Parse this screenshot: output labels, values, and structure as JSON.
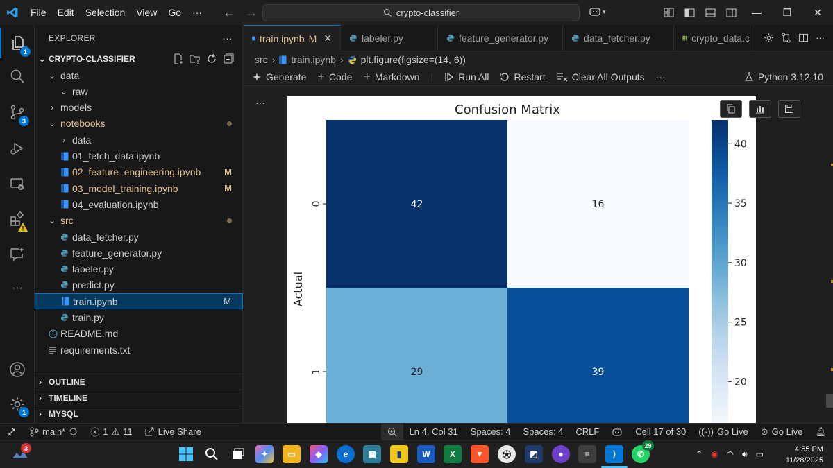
{
  "menu": {
    "file": "File",
    "edit": "Edit",
    "selection": "Selection",
    "view": "View",
    "go": "Go",
    "more": "···"
  },
  "search": {
    "text": "crypto-classifier"
  },
  "activity_badges": {
    "explorer": "1",
    "source_control": "3",
    "accounts_settings": "1"
  },
  "explorer": {
    "title": "EXPLORER",
    "project": "CRYPTO-CLASSIFIER",
    "items": [
      {
        "label": "data",
        "type": "folder-open",
        "indent": 1
      },
      {
        "label": "raw",
        "type": "folder-open",
        "indent": 2
      },
      {
        "label": "models",
        "type": "folder",
        "indent": 1
      },
      {
        "label": "notebooks",
        "type": "folder-open",
        "indent": 1,
        "modified": true,
        "status": "dot"
      },
      {
        "label": "data",
        "type": "folder",
        "indent": 2
      },
      {
        "label": "01_fetch_data.ipynb",
        "type": "notebook",
        "indent": 2
      },
      {
        "label": "02_feature_engineering.ipynb",
        "type": "notebook",
        "indent": 2,
        "modified": true,
        "status": "M"
      },
      {
        "label": "03_model_training.ipynb",
        "type": "notebook",
        "indent": 2,
        "modified": true,
        "status": "M"
      },
      {
        "label": "04_evaluation.ipynb",
        "type": "notebook",
        "indent": 2
      },
      {
        "label": "src",
        "type": "folder-open",
        "indent": 1,
        "modified": true,
        "status": "dot"
      },
      {
        "label": "data_fetcher.py",
        "type": "python",
        "indent": 2
      },
      {
        "label": "feature_generator.py",
        "type": "python",
        "indent": 2
      },
      {
        "label": "labeler.py",
        "type": "python",
        "indent": 2
      },
      {
        "label": "predict.py",
        "type": "python",
        "indent": 2
      },
      {
        "label": "train.ipynb",
        "type": "notebook",
        "indent": 2,
        "selected": true,
        "status": "M"
      },
      {
        "label": "train.py",
        "type": "python",
        "indent": 2
      },
      {
        "label": "README.md",
        "type": "info",
        "indent": 1
      },
      {
        "label": "requirements.txt",
        "type": "text",
        "indent": 1
      }
    ],
    "sections": [
      "OUTLINE",
      "TIMELINE",
      "MYSQL"
    ]
  },
  "tabs": [
    {
      "label": "train.ipynb",
      "suffix": "M",
      "icon": "notebook",
      "active": true
    },
    {
      "label": "labeler.py",
      "icon": "python"
    },
    {
      "label": "feature_generator.py",
      "icon": "python"
    },
    {
      "label": "data_fetcher.py",
      "icon": "python"
    },
    {
      "label": "crypto_data.c",
      "icon": "csv"
    }
  ],
  "breadcrumb": [
    "src",
    "train.ipynb",
    "plt.figure(figsize=(14, 6))"
  ],
  "toolbar": {
    "generate": "Generate",
    "code": "Code",
    "markdown": "Markdown",
    "run_all": "Run All",
    "restart": "Restart",
    "clear": "Clear All Outputs",
    "more": "···",
    "kernel": "Python 3.12.10"
  },
  "cell_more": "···",
  "chart_data": {
    "type": "heatmap",
    "title": "Confusion Matrix",
    "ylabel": "Actual",
    "row_labels": [
      "0",
      "1"
    ],
    "matrix": [
      [
        42,
        16
      ],
      [
        29,
        39
      ]
    ],
    "colorbar_ticks": [
      20,
      25,
      30,
      35,
      40
    ],
    "colormap": "Blues",
    "vmin": 16,
    "vmax": 42
  },
  "status": {
    "branch": "main*",
    "errors": "1",
    "warnings": "11",
    "live_share": "Live Share",
    "position": "Ln 4, Col 31",
    "spaces1": "Spaces: 4",
    "spaces2": "Spaces: 4",
    "eol": "CRLF",
    "cell": "Cell 17 of 30",
    "go_live1": "Go Live",
    "go_live2": "Go Live"
  },
  "taskbar": {
    "time": "4:55 PM",
    "date": "11/28/2025",
    "notif_badge": "3",
    "whatsapp_badge": "29"
  }
}
